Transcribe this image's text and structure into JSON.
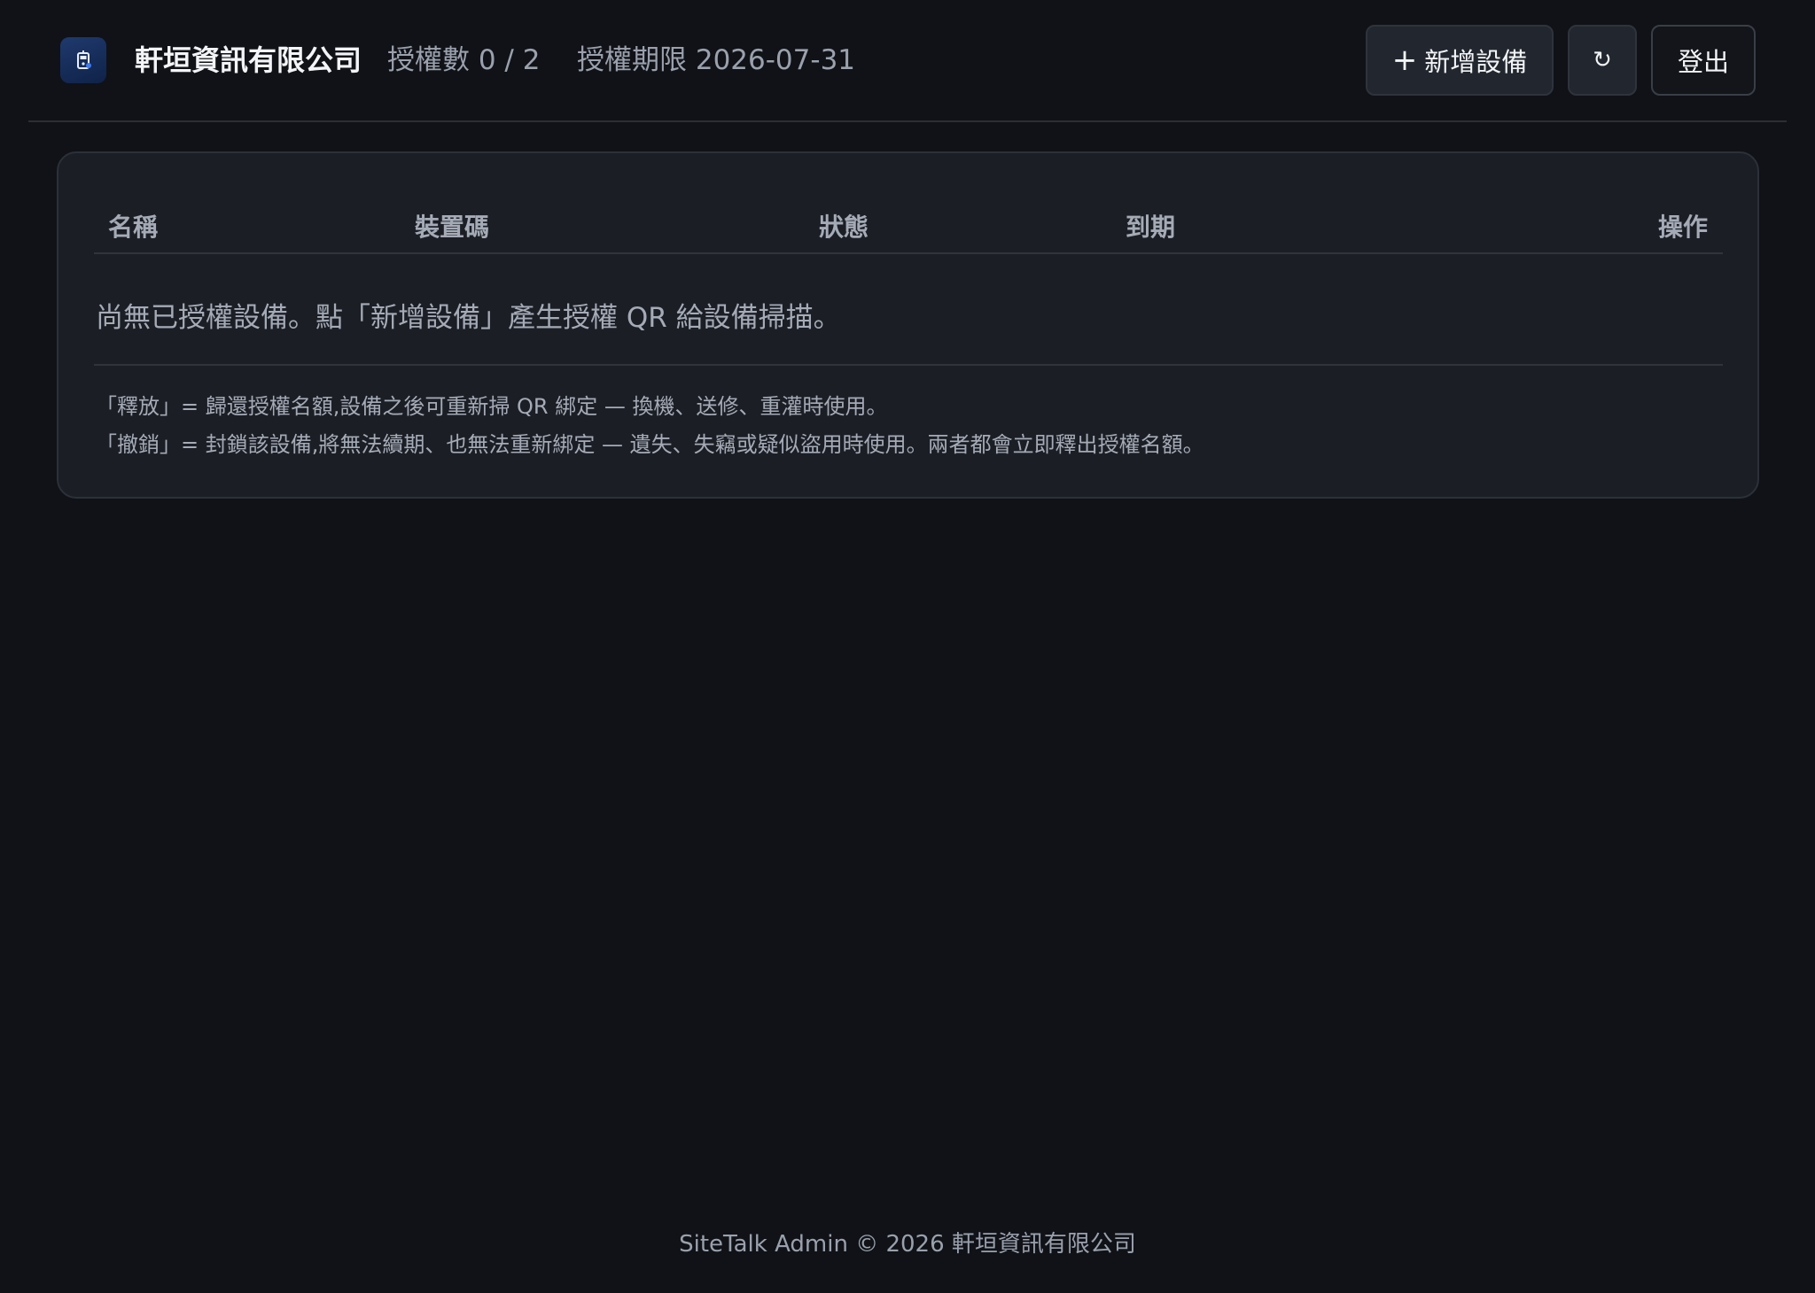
{
  "header": {
    "logo_icon": "app-logo-icon",
    "company_name": "軒垣資訊有限公司",
    "license_count": "授權數 0 / 2",
    "license_expiry": "授權期限 2026-07-31",
    "add_device_plus": "+",
    "add_device_label": "新增設備",
    "refresh_label": "↻",
    "logout_label": "登出"
  },
  "table": {
    "columns": [
      "名稱",
      "裝置碼",
      "狀態",
      "到期",
      "操作"
    ],
    "rows": [],
    "empty_message": "尚無已授權設備。點「新增設備」產生授權 QR 給設備掃描。"
  },
  "notes": [
    "「釋放」= 歸還授權名額,設備之後可重新掃 QR 綁定 — 換機、送修、重灌時使用。",
    "「撤銷」= 封鎖該設備,將無法續期、也無法重新綁定 — 遺失、失竊或疑似盜用時使用。兩者都會立即釋出授權名額。"
  ],
  "footer": {
    "text": "SiteTalk Admin © 2026 軒垣資訊有限公司"
  },
  "colors": {
    "background": "#101217",
    "card": "#1b1e25",
    "logo": "#1f3a6e"
  }
}
